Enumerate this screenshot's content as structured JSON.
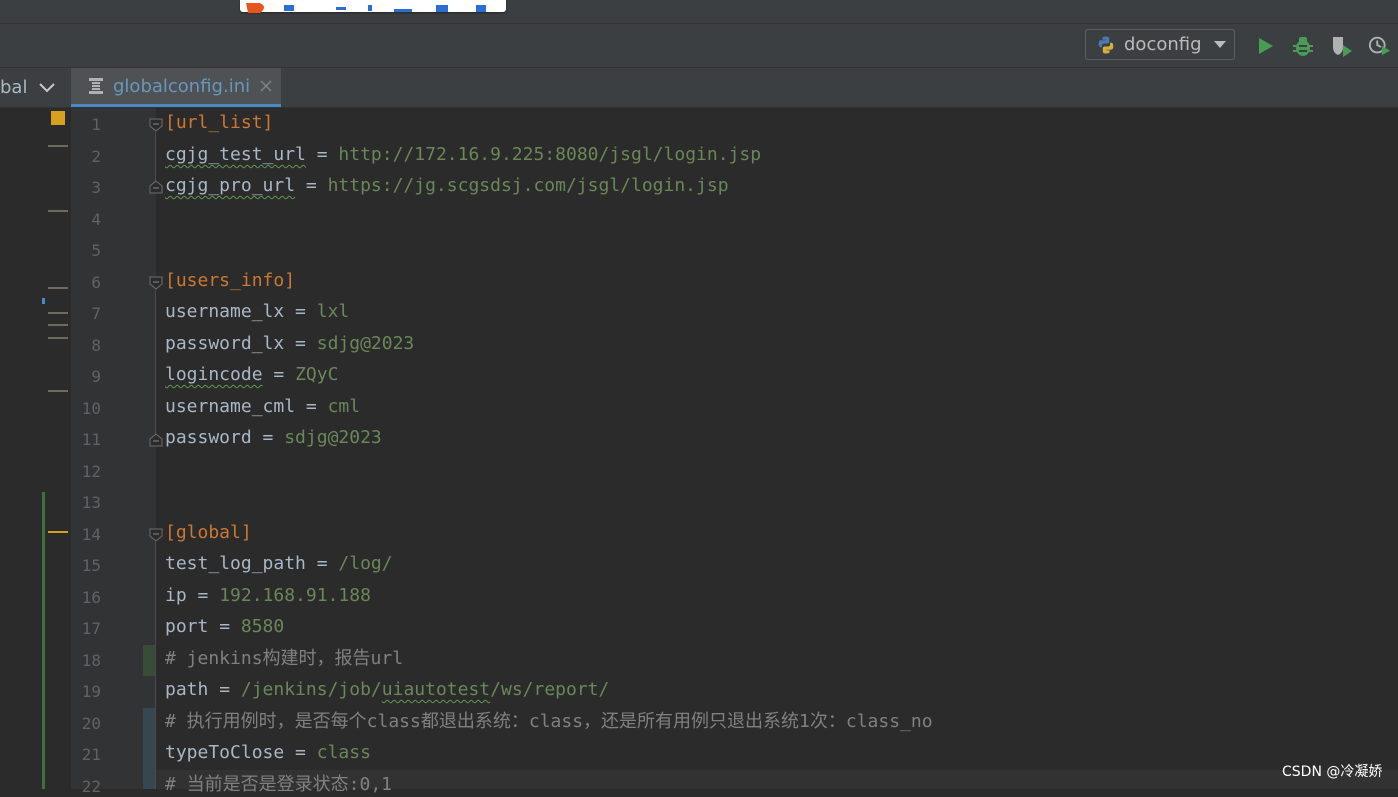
{
  "toolbar": {
    "run_config_label": "doconfig",
    "icons": [
      "python-icon",
      "run-icon",
      "debug-icon",
      "coverage-icon",
      "profile-icon"
    ]
  },
  "tabs": {
    "left_partial_label": "bal",
    "active_label": "globalconfig.ini"
  },
  "editor": {
    "line_numbers": [
      "1",
      "2",
      "3",
      "4",
      "5",
      "6",
      "7",
      "8",
      "9",
      "10",
      "11",
      "12",
      "13",
      "14",
      "15",
      "16",
      "17",
      "18",
      "19",
      "20",
      "21",
      "22"
    ],
    "lines": {
      "l1": {
        "section": "[url_list]"
      },
      "l2": {
        "key": "cgjg_test_url",
        "op": " = ",
        "value": "http://172.16.9.225:8080/jsgl/login.jsp"
      },
      "l3": {
        "key": "cgjg_pro_url",
        "op": " = ",
        "value": "https://jg.scgsdsj.com/jsgl/login.jsp"
      },
      "l6": {
        "section": "[users_info]"
      },
      "l7": {
        "key": "username_lx",
        "op": " = ",
        "value": "lxl"
      },
      "l8": {
        "key": "password_lx",
        "op": " = ",
        "value": "sdjg@2023"
      },
      "l9": {
        "key": "logincode",
        "op": " = ",
        "value": "ZQyC"
      },
      "l10": {
        "key": "username_cml",
        "op": " = ",
        "value": "cml"
      },
      "l11": {
        "key": "password",
        "op": " = ",
        "value": "sdjg@2023"
      },
      "l14": {
        "section": "[global]"
      },
      "l15": {
        "key": "test_log_path",
        "op": " = ",
        "value": "/log/"
      },
      "l16": {
        "key": "ip",
        "op": " = ",
        "value": "192.168.91.188"
      },
      "l17": {
        "key": "port",
        "op": " = ",
        "value": "8580"
      },
      "l18": {
        "comment": "# jenkins构建时，报告url"
      },
      "l19": {
        "key": "path",
        "op": " = ",
        "value_a": "/jenkins/job/",
        "value_b": "uiautotest",
        "value_c": "/ws/report/"
      },
      "l20": {
        "comment": "# 执行用例时，是否每个class都退出系统：class，还是所有用例只退出系统1次：class_no"
      },
      "l21": {
        "key": "typeToClose",
        "op": " = ",
        "value": "class"
      },
      "l22": {
        "comment": "# 当前是否是登录状态:0,1"
      }
    }
  },
  "watermark": "CSDN @冷凝娇",
  "colors": {
    "section": "#cc7832",
    "value": "#6a8759",
    "comment": "#808080",
    "key": "#a9b7c6",
    "tab_label": "#6897bb",
    "accent": "#4a88c7"
  }
}
